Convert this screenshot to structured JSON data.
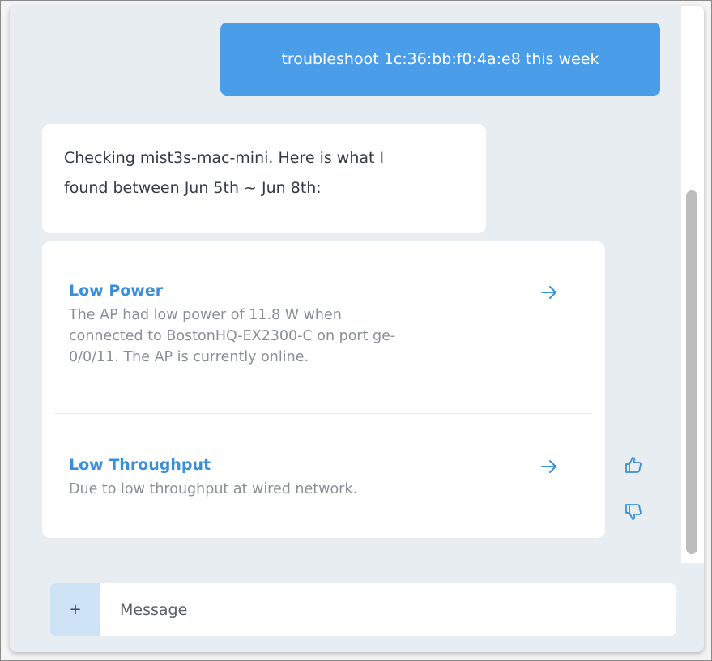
{
  "messages": {
    "user": "troubleshoot 1c:36:bb:f0:4a:e8 this week",
    "bot_line1": "Checking mist3s-mac-mini. Here is what I",
    "bot_line2": "found between Jun 5th ~ Jun 8th:"
  },
  "results": [
    {
      "title": "Low Power",
      "desc_lines": [
        "The AP had low power of 11.8 W when",
        "connected to BostonHQ-EX2300-C on port ge-",
        "0/0/11. The AP is currently online."
      ],
      "icon": "arrow-right-icon"
    },
    {
      "title": "Low Throughput",
      "desc_lines": [
        "Due to low throughput at wired network."
      ],
      "icon": "arrow-right-icon"
    }
  ],
  "feedback": {
    "up_icon": "thumbs-up-icon",
    "down_icon": "thumbs-down-icon"
  },
  "composer": {
    "plus_label": "+",
    "placeholder": "Message"
  },
  "colors": {
    "accent": "#4a9de8",
    "link": "#3a8fd9",
    "panel_bg": "#e8edf2",
    "muted_text": "#8a8f96"
  }
}
